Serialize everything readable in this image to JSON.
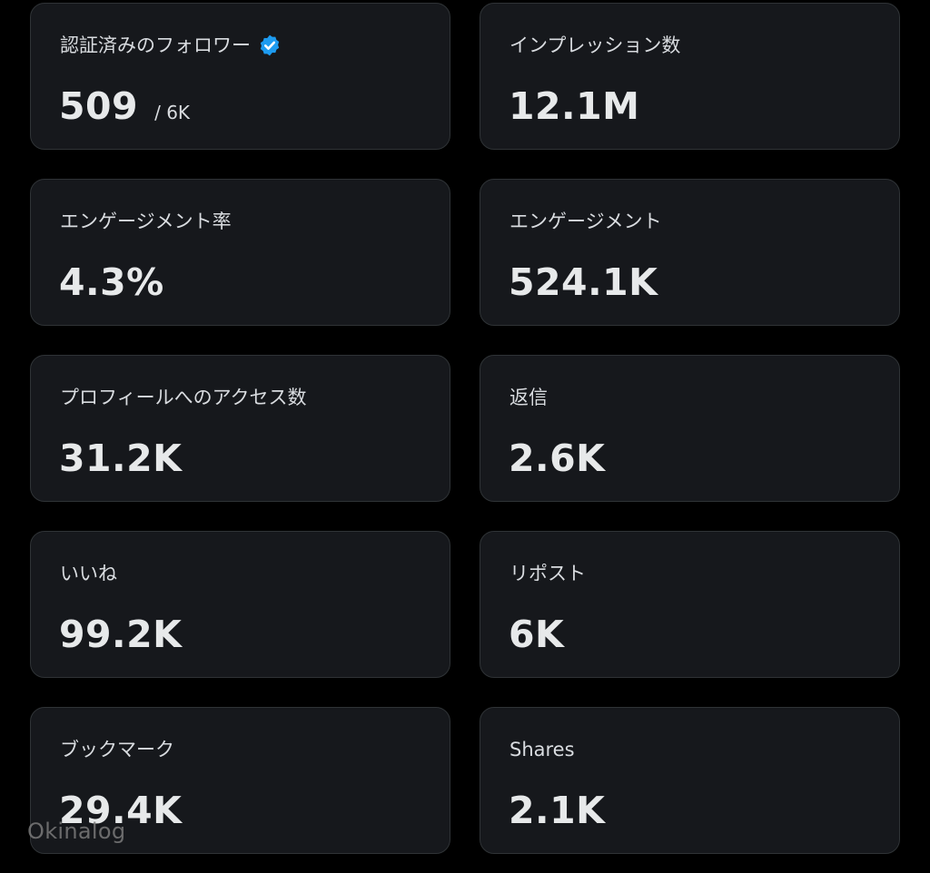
{
  "cards": [
    {
      "label": "認証済みのフォロワー",
      "value": "509",
      "sub": "/ 6K",
      "icon": "verified-badge-icon"
    },
    {
      "label": "インプレッション数",
      "value": "12.1M"
    },
    {
      "label": "エンゲージメント率",
      "value": "4.3%"
    },
    {
      "label": "エンゲージメント",
      "value": "524.1K"
    },
    {
      "label": "プロフィールへのアクセス数",
      "value": "31.2K"
    },
    {
      "label": "返信",
      "value": "2.6K"
    },
    {
      "label": "いいね",
      "value": "99.2K"
    },
    {
      "label": "リポスト",
      "value": "6K"
    },
    {
      "label": "ブックマーク",
      "value": "29.4K"
    },
    {
      "label": "Shares",
      "value": "2.1K"
    }
  ],
  "watermark": "Okinalog",
  "colors": {
    "background": "#000000",
    "card": "#16181c",
    "border": "#2f3336",
    "verified": "#1d9bf0"
  }
}
